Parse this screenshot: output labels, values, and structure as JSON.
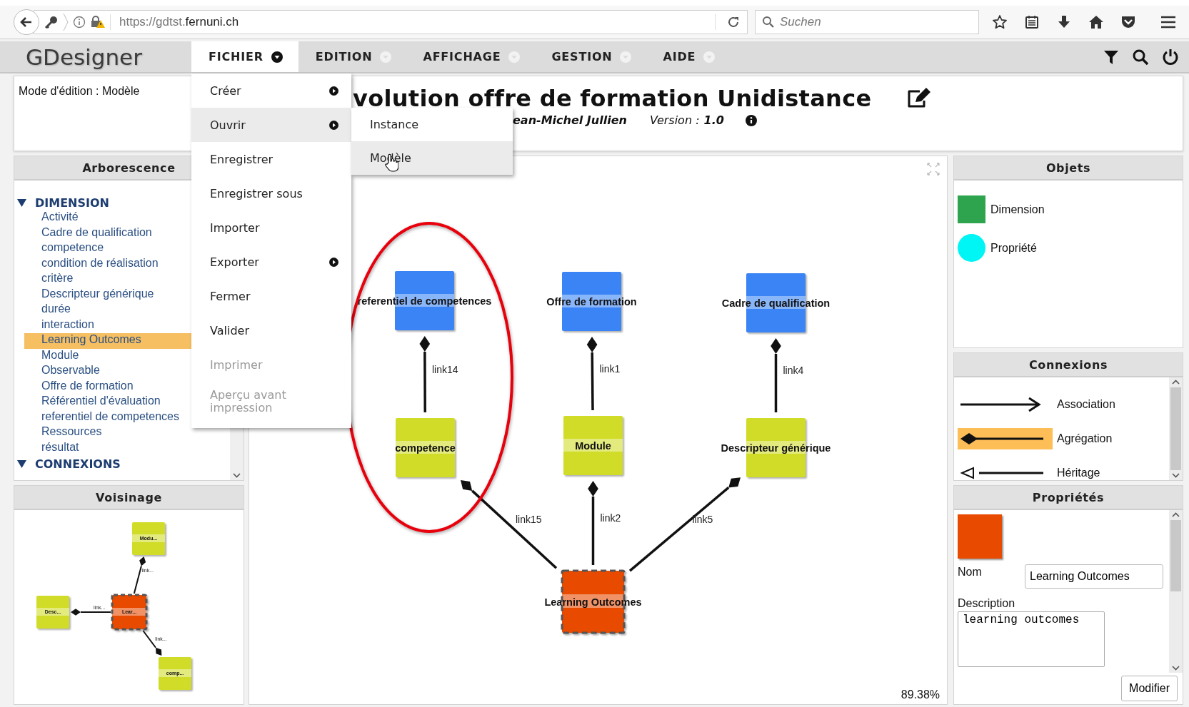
{
  "browser": {
    "url_prefix": "https://gdtst.",
    "url_domain": "fernuni.ch",
    "search_placeholder": "Suchen"
  },
  "menubar": {
    "logo": "GDesigner",
    "menus": [
      {
        "label": "FICHIER",
        "selected": true
      },
      {
        "label": "EDITION",
        "selected": false
      },
      {
        "label": "AFFICHAGE",
        "selected": false
      },
      {
        "label": "GESTION",
        "selected": false
      },
      {
        "label": "AIDE",
        "selected": false
      }
    ]
  },
  "file_menu": {
    "items": [
      {
        "label": "Créer",
        "has_submenu": true,
        "disabled": false,
        "selected": false
      },
      {
        "label": "Ouvrir",
        "has_submenu": true,
        "disabled": false,
        "selected": true
      },
      {
        "label": "Enregistrer",
        "has_submenu": false,
        "disabled": false,
        "selected": false
      },
      {
        "label": "Enregistrer sous",
        "has_submenu": false,
        "disabled": false,
        "selected": false
      },
      {
        "label": "Importer",
        "has_submenu": false,
        "disabled": false,
        "selected": false
      },
      {
        "label": "Exporter",
        "has_submenu": true,
        "disabled": false,
        "selected": false
      },
      {
        "label": "Fermer",
        "has_submenu": false,
        "disabled": false,
        "selected": false
      },
      {
        "label": "Valider",
        "has_submenu": false,
        "disabled": false,
        "selected": false
      },
      {
        "label": "Imprimer",
        "has_submenu": false,
        "disabled": true,
        "selected": false
      },
      {
        "label": "Aperçu avant impression",
        "has_submenu": false,
        "disabled": true,
        "selected": false
      }
    ],
    "submenu": [
      {
        "label": "Instance",
        "selected": false
      },
      {
        "label": "Modèle",
        "selected": true
      }
    ]
  },
  "header": {
    "mode": "Mode d'édition : Modèle",
    "title": "volution offre de formation Unidistance",
    "author": "ean-Michel Jullien",
    "version_label": "Version :",
    "version": "1.0"
  },
  "tree": {
    "title": "Arborescence",
    "sections": [
      {
        "label": "DIMENSION",
        "expanded": true,
        "children": [
          {
            "label": "Activité",
            "selected": false
          },
          {
            "label": "Cadre de qualification",
            "selected": false
          },
          {
            "label": "competence",
            "selected": false
          },
          {
            "label": "condition de réalisation",
            "selected": false
          },
          {
            "label": "critère",
            "selected": false
          },
          {
            "label": "Descripteur générique",
            "selected": false
          },
          {
            "label": "durée",
            "selected": false
          },
          {
            "label": "interaction",
            "selected": false
          },
          {
            "label": "Learning Outcomes",
            "selected": true
          },
          {
            "label": "Module",
            "selected": false
          },
          {
            "label": "Observable",
            "selected": false
          },
          {
            "label": "Offre de formation",
            "selected": false
          },
          {
            "label": "Référentiel d'évaluation",
            "selected": false
          },
          {
            "label": "referentiel de competences",
            "selected": false
          },
          {
            "label": "Ressources",
            "selected": false
          },
          {
            "label": "résultat",
            "selected": false
          }
        ]
      },
      {
        "label": "CONNEXIONS",
        "expanded": true
      }
    ]
  },
  "neighborhood": {
    "title": "Voisinage",
    "nodes": [
      {
        "label": "Modu...",
        "color": "#d1dc28",
        "selected": false
      },
      {
        "label": "Desc...",
        "color": "#d1dc28",
        "selected": false
      },
      {
        "label": "Lear...",
        "color": "#e84a00",
        "selected": true
      },
      {
        "label": "comp...",
        "color": "#d1dc28",
        "selected": false
      }
    ],
    "links": [
      {
        "label": "link..."
      },
      {
        "label": "link..."
      },
      {
        "label": "link..."
      }
    ]
  },
  "diagram": {
    "zoom": "89.38%",
    "nodes": [
      {
        "label": "referentiel de competences",
        "color": "#3b84f5",
        "selected": false
      },
      {
        "label": "Offre de formation",
        "color": "#3b84f5",
        "selected": false
      },
      {
        "label": "Cadre de qualification",
        "color": "#3b84f5",
        "selected": false
      },
      {
        "label": "competence",
        "color": "#d1dc28",
        "selected": false
      },
      {
        "label": "Module",
        "color": "#d1dc28",
        "selected": false
      },
      {
        "label": "Descripteur générique",
        "color": "#d1dc28",
        "selected": false
      },
      {
        "label": "Learning Outcomes",
        "color": "#e84a00",
        "selected": true
      }
    ],
    "links": [
      {
        "label": "link14"
      },
      {
        "label": "link1"
      },
      {
        "label": "link4"
      },
      {
        "label": "link15"
      },
      {
        "label": "link2"
      },
      {
        "label": "link5"
      }
    ]
  },
  "objects": {
    "title": "Objets",
    "items": [
      {
        "label": "Dimension",
        "kind": "square",
        "color": "#2ea44f"
      },
      {
        "label": "Propriété",
        "kind": "circle",
        "color": "#00f5f5"
      }
    ]
  },
  "connections": {
    "title": "Connexions",
    "items": [
      {
        "label": "Association",
        "kind": "association",
        "selected": false
      },
      {
        "label": "Agrégation",
        "kind": "aggregation",
        "selected": true
      },
      {
        "label": "Héritage",
        "kind": "inheritance",
        "selected": false
      }
    ]
  },
  "properties": {
    "title": "Propriétés",
    "color": "#e84a00",
    "name_label": "Nom",
    "name_value": "Learning Outcomes",
    "description_label": "Description",
    "description_value": "learning outcomes",
    "button": "Modifier"
  }
}
